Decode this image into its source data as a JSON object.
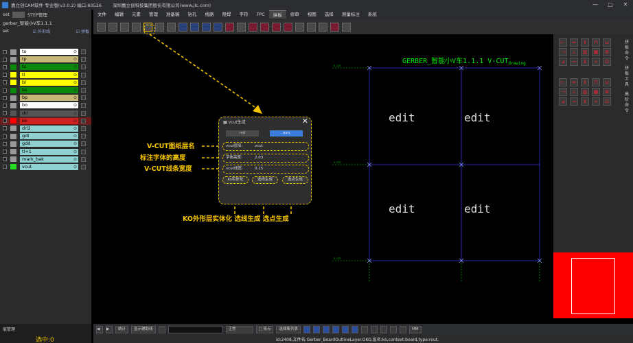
{
  "window": {
    "title": "嘉立创CAM软件 专业版(v3.0.2) 端口:60526",
    "company": "深圳嘉立创科技集团股份有限公司(www.jlc.com)",
    "controls": [
      "—",
      "▢",
      "✕"
    ]
  },
  "left_panel": {
    "tabs": [
      "set",
      "STEP管理"
    ],
    "project": "gerber_智能小V车1.1.1",
    "set_label": "set",
    "options": [
      "外形线",
      "拼板"
    ],
    "layers": [
      {
        "name": "to",
        "color": "#ffffff",
        "box": "#999999"
      },
      {
        "name": "tp",
        "color": "#c8b878",
        "box": "#999999"
      },
      {
        "name": "ts",
        "color": "#0a8a0a",
        "box": "#0a8a0a"
      },
      {
        "name": "tl",
        "color": "#ffff00",
        "box": "#ffff00"
      },
      {
        "name": "bl",
        "color": "#ffff00",
        "box": "#ffff00"
      },
      {
        "name": "bs",
        "color": "#0a8a0a",
        "box": "#0a8a0a"
      },
      {
        "name": "bp",
        "color": "#c8b878",
        "box": "#999999"
      },
      {
        "name": "bo",
        "color": "#ffffff",
        "box": "#999999"
      },
      {
        "name": "drl",
        "color": "#555555",
        "box": "#555555"
      },
      {
        "name": "ko",
        "color": "#d02020",
        "box": "#ff0000"
      },
      {
        "name": "drl2",
        "color": "#8fd0d0",
        "box": "#999999"
      },
      {
        "name": "gdl",
        "color": "#8fd0d0",
        "box": "#999999"
      },
      {
        "name": "gdd",
        "color": "#8fd0d0",
        "box": "#999999"
      },
      {
        "name": "tl+1",
        "color": "#8fd0d0",
        "box": "#999999"
      },
      {
        "name": "mark_bak",
        "color": "#8fd0d0",
        "box": "#999999"
      },
      {
        "name": "vcut",
        "color": "#8fd0d0",
        "box": "#22dd22"
      }
    ],
    "footer_label": "层管理",
    "selection": "选中:0"
  },
  "menu": [
    "文件",
    "编辑",
    "元素",
    "管理",
    "准备稿",
    "钻孔",
    "线路",
    "阻焊",
    "字符",
    "FPC",
    "拼板",
    "修审",
    "视图",
    "选择",
    "测量标注",
    "系统"
  ],
  "active_menu": "拼板",
  "right_panel": {
    "side_labels": [
      "拼板命令",
      "拼板工具",
      "高阶命令"
    ]
  },
  "canvas": {
    "heading": "GERBER_智能小V车1.1.1  V-CUT",
    "heading_suffix": "drawing",
    "cell_text": "edit"
  },
  "dialog": {
    "title": "vcut生成",
    "tabs": [
      "mil",
      "mm"
    ],
    "fields": [
      {
        "label": "vcut层名:",
        "value": "vcut"
      },
      {
        "label": "字体高度:",
        "value": "2.03"
      },
      {
        "label": "vcut线宽:",
        "value": "0.15"
      }
    ],
    "buttons": [
      "ko实体化",
      "选线生成",
      "选点生成"
    ]
  },
  "annotations": {
    "layer_name": "V-CUT图纸层名",
    "font_height": "标注字体的高度",
    "line_width": "V-CUT线条宽度",
    "bottom": "KO外形层实体化  选线生成  选点生成"
  },
  "bottom_bar": {
    "combo1": "统计",
    "btn": "显示辅助线",
    "combo2": "正常",
    "cb1": "□ 吸点",
    "cb2": "选择集列表",
    "unit": "MM"
  },
  "status": "id:2408,文件名:Gerber_BoardOutlineLayer.GKO,层名:ko,context:board,type:rout,"
}
